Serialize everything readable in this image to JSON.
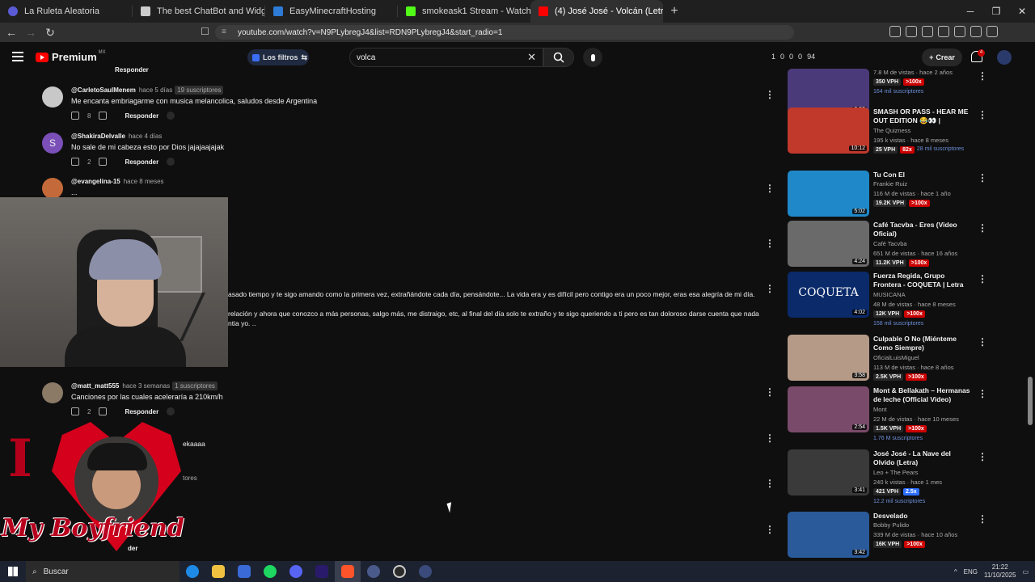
{
  "browser": {
    "tabs": [
      {
        "label": "La Ruleta Aleatoria",
        "color": "#5b5bd6"
      },
      {
        "label": "The best ChatBot and Widgets for Ki",
        "color": "#cccccc"
      },
      {
        "label": "EasyMinecraftHosting",
        "color": "#2d7bd6"
      },
      {
        "label": "smokeask1 Stream - Watch Live on Ki",
        "color": "#53fc18"
      },
      {
        "label": "(4) José José - Volcán (Letra / ",
        "color": "#ff0000"
      }
    ],
    "new_tab": "+",
    "url": "youtube.com/watch?v=N9PLybregJ4&list=RDN9PLybregJ4&start_radio=1"
  },
  "yt": {
    "logo": "Premium",
    "region": "MX",
    "filters_label": "Los filtros",
    "search_value": "volca",
    "stats": [
      "1",
      "0",
      "0",
      "0",
      "94"
    ],
    "create_label": "Crear",
    "notif_count": "4"
  },
  "comments": [
    {
      "name": "@CarletoSaulMenem",
      "time": "hace 5 días",
      "subs": "19 suscriptores",
      "text": "Me encanta embriagarme con musica melancolica, saludos desde Argentina",
      "likes": "8",
      "reply": "Responder",
      "avatar": "#c8c8c8"
    },
    {
      "name": "@ShakiraDelvalle",
      "time": "hace 4 días",
      "subs": "",
      "text": "No sale de mi cabeza esto por Dios jajajaajajak",
      "likes": "2",
      "reply": "Responder",
      "avatar": "#7b4fb8",
      "initial": "S"
    },
    {
      "name": "@evangelina-15",
      "time": "hace 8 meses",
      "subs": "",
      "text": "...",
      "likes": "",
      "reply": "",
      "avatar": "#c46a3a"
    },
    {
      "name": "@matt_matt555",
      "time": "hace 3 semanas",
      "subs": "1 suscriptores",
      "text": "Canciones por las cuales aceleraría a 210km/h",
      "likes": "2",
      "reply": "Responder",
      "avatar": "#8a7a66"
    }
  ],
  "partial_texts": {
    "line1": "asado tiempo y te sigo amando como la primera vez, extrañándote cada día, pensándote... La vida era y es difícil pero contigo era un poco mejor, eras esa alegría de mi día.",
    "line2": "relación y ahora que conozco a más personas, salgo más, me distraigo, etc, al final del día solo te extraño y te sigo queriendo a ti pero es tan doloroso darse cuenta que nada",
    "line3": "ntia yo. ..",
    "tail1": "ekaaaa",
    "tail2": "tores",
    "top_reply": "Responder",
    "bottom_reply": "der"
  },
  "overlay": {
    "letter": "I",
    "caption": "My Boyfriend"
  },
  "sidebar": [
    {
      "title": "",
      "channel": "",
      "views": "7.8 M de vistas · hace 2 años",
      "duration": "3:52",
      "vph": "350 VPH",
      "pct": ">100x",
      "subs": "164 mil suscriptores",
      "thumb": "#4a3a7a"
    },
    {
      "title": "SMASH OR PASS - HEAR ME OUT EDITION 😂👀 | Celebrity...",
      "channel": "The Quizness",
      "views": "195 k vistas · hace 8 meses",
      "duration": "10:12",
      "vph": "25 VPH",
      "pct": "82x",
      "subs": "28 mil suscriptores",
      "thumb": "#c0392b"
    },
    {
      "title": "Tu Con El",
      "channel": "Frankie Ruiz",
      "views": "116 M de vistas · hace 1 año",
      "duration": "5:02",
      "vph": "19.2K VPH",
      "pct": ">100x",
      "subs": "",
      "thumb": "#1e88c8"
    },
    {
      "title": "Café Tacvba - Eres (Video Oficial)",
      "channel": "Café Tacvba",
      "views": "651 M de vistas · hace 16 años",
      "duration": "4:24",
      "vph": "11.2K VPH",
      "pct": ">100x",
      "subs": "",
      "thumb": "#6a6a6a"
    },
    {
      "title": "Fuerza Regida, Grupo Frontera - COQUETA | Letra",
      "channel": "MUSICANA",
      "views": "48 M de vistas · hace 8 meses",
      "duration": "4:02",
      "vph": "12K VPH",
      "pct": ">100x",
      "subs": "158 mil suscriptores",
      "thumb": "#0a2a6a",
      "label": "COQUETA"
    },
    {
      "title": "Culpable O No (Miénteme Como Siempre)",
      "channel": "OficialLuisMiguel",
      "views": "113 M de vistas · hace 8 años",
      "duration": "3:58",
      "vph": "2.5K VPH",
      "pct": ">100x",
      "subs": "",
      "thumb": "#b59a88"
    },
    {
      "title": "Mont & Bellakath – Hermanas de leche (Official Video)",
      "channel": "Mont",
      "views": "22 M de vistas · hace 10 meses",
      "duration": "2:54",
      "vph": "1.5K VPH",
      "pct": ">100x",
      "subs": "1.76 M suscriptores",
      "thumb": "#7a4a6a"
    },
    {
      "title": "José José - La Nave del Olvido (Letra)",
      "channel": "Leo + The Pears",
      "views": "240 k vistas · hace 1 mes",
      "duration": "3:41",
      "vph": "421 VPH",
      "pct": "2.5x",
      "pctblue": true,
      "subs": "12.2 mil suscriptores",
      "thumb": "#3a3a3a"
    },
    {
      "title": "Desvelado",
      "channel": "Bobby Pulido",
      "views": "339 M de vistas · hace 10 años",
      "duration": "3:42",
      "vph": "16K VPH",
      "pct": ">100x",
      "subs": "",
      "thumb": "#2a5a9a"
    }
  ],
  "taskbar": {
    "search": "Buscar",
    "lang": "ENG",
    "time": "21:22",
    "date": "11/10/2025"
  }
}
